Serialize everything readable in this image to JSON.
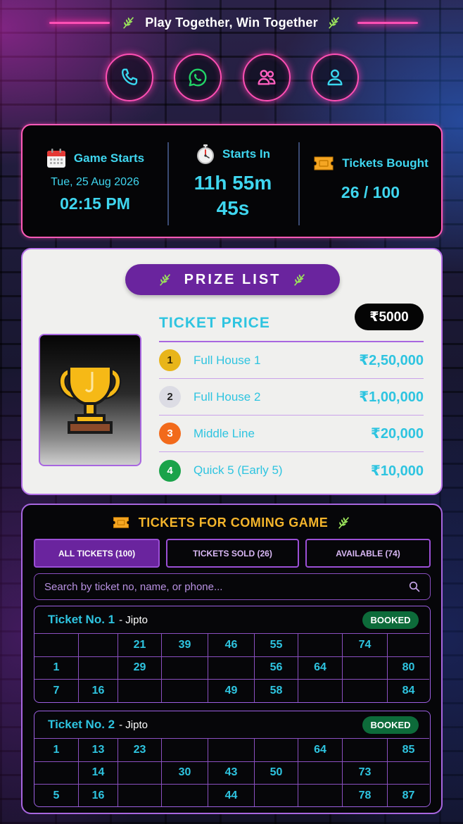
{
  "header": {
    "title": "Play Together, Win Together"
  },
  "contacts": [
    {
      "icon": "phone-icon"
    },
    {
      "icon": "whatsapp-icon"
    },
    {
      "icon": "group-icon"
    },
    {
      "icon": "user-icon"
    }
  ],
  "stats": {
    "game_starts": {
      "label": "Game Starts",
      "date": "Tue, 25 Aug 2026",
      "time": "02:15 PM"
    },
    "starts_in": {
      "label": "Starts In",
      "hours_minutes": "11h 55m",
      "seconds": "45s"
    },
    "tickets_bought": {
      "label": "Tickets Bought",
      "value": "26 / 100"
    }
  },
  "prize": {
    "title": "PRIZE LIST",
    "ticket_price_label": "TICKET PRICE",
    "ticket_price": "₹5000",
    "items": [
      {
        "rank": "1",
        "name": "Full House 1",
        "amount": "₹2,50,000",
        "color": "#e8b51a"
      },
      {
        "rank": "2",
        "name": "Full House 2",
        "amount": "₹1,00,000",
        "color": "#dcdce4"
      },
      {
        "rank": "3",
        "name": "Middle Line",
        "amount": "₹20,000",
        "color": "#f26a1b"
      },
      {
        "rank": "4",
        "name": "Quick 5 (Early 5)",
        "amount": "₹10,000",
        "color": "#1aa34a"
      }
    ]
  },
  "tickets": {
    "title": "TICKETS FOR COMING GAME",
    "tabs": [
      {
        "label": "ALL TICKETS (100)",
        "active": true
      },
      {
        "label": "TICKETS SOLD (26)",
        "active": false
      },
      {
        "label": "AVAILABLE (74)",
        "active": false
      }
    ],
    "search_placeholder": "Search by ticket no, name, or phone...",
    "list": [
      {
        "label": "Ticket No. 1",
        "holder": "- Jipto",
        "status": "BOOKED",
        "rows": [
          [
            "",
            "",
            "21",
            "39",
            "46",
            "55",
            "",
            "74",
            ""
          ],
          [
            "1",
            "",
            "29",
            "",
            "",
            "56",
            "64",
            "",
            "80"
          ],
          [
            "7",
            "16",
            "",
            "",
            "49",
            "58",
            "",
            "",
            "84"
          ]
        ]
      },
      {
        "label": "Ticket No. 2",
        "holder": "- Jipto",
        "status": "BOOKED",
        "rows": [
          [
            "1",
            "13",
            "23",
            "",
            "",
            "",
            "64",
            "",
            "85"
          ],
          [
            "",
            "14",
            "",
            "30",
            "43",
            "50",
            "",
            "73",
            ""
          ],
          [
            "5",
            "16",
            "",
            "",
            "44",
            "",
            "",
            "78",
            "87"
          ]
        ]
      }
    ]
  },
  "colors": {
    "accent_cyan": "#2ec4e0",
    "neon_pink": "#ff4fb4",
    "purple": "#6a249e",
    "gold": "#f5b52b",
    "booked_green": "#0d6b3a"
  }
}
